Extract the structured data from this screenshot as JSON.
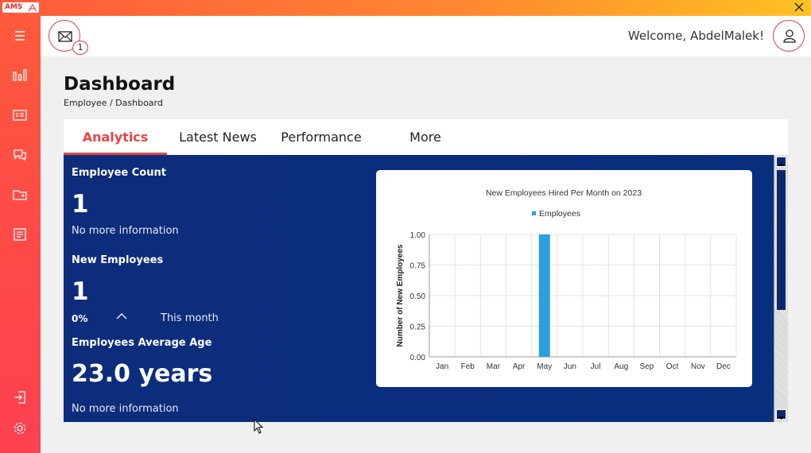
{
  "app": {
    "logo_text": "AMS"
  },
  "header": {
    "welcome": "Welcome, AbdelMalek!",
    "mail_badge": "1"
  },
  "page": {
    "title": "Dashboard",
    "breadcrumb": "Employee / Dashboard"
  },
  "tabs": [
    {
      "label": "Analytics",
      "active": true
    },
    {
      "label": "Latest News",
      "active": false
    },
    {
      "label": "Performance",
      "active": false
    },
    {
      "label": "More",
      "active": false
    }
  ],
  "stats": {
    "employee_count": {
      "title": "Employee Count",
      "value": "1",
      "sub": "No more information"
    },
    "new_employees": {
      "title": "New Employees",
      "value": "1",
      "percent": "0%",
      "period": "This month"
    },
    "average_age": {
      "title": "Employees Average Age",
      "value": "23.0 years",
      "sub": "No more information"
    }
  },
  "sidebar": {
    "icons": [
      "menu-icon",
      "bar-chart-icon",
      "id-card-icon",
      "chat-icon",
      "folder-icon",
      "document-icon",
      "logout-icon",
      "gear-icon"
    ]
  },
  "colors": {
    "accent": "#e84545",
    "panel": "#0a2e7c",
    "bar": "#2b9fdf"
  },
  "chart_data": {
    "type": "bar",
    "title": "New Employees Hired Per Month on 2023",
    "ylabel": "Number of New Employees",
    "xlabel": "",
    "categories": [
      "Jan",
      "Feb",
      "Mar",
      "Apr",
      "May",
      "Jun",
      "Jul",
      "Aug",
      "Sep",
      "Oct",
      "Nov",
      "Dec"
    ],
    "series": [
      {
        "name": "Employees",
        "values": [
          0,
          0,
          0,
          0,
          1,
          0,
          0,
          0,
          0,
          0,
          0,
          0
        ]
      }
    ],
    "ylim": [
      0,
      1
    ],
    "yticks": [
      "0.00",
      "0.25",
      "0.50",
      "0.75",
      "1.00"
    ],
    "legend": "top",
    "grid": true
  }
}
